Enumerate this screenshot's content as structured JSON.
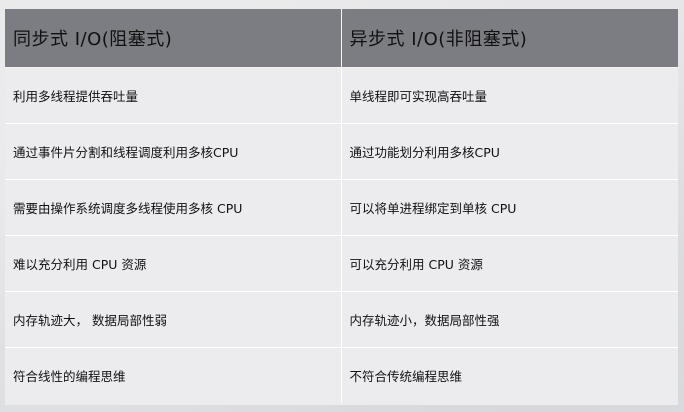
{
  "table": {
    "headers": [
      "同步式 I/O(阻塞式)",
      "异步式 I/O(非阻塞式)"
    ],
    "rows": [
      [
        "利用多线程提供吞吐量",
        "单线程即可实现高吞吐量"
      ],
      [
        "通过事件片分割和线程调度利用多核CPU",
        "通过功能划分利用多核CPU"
      ],
      [
        "需要由操作系统调度多线程使用多核 CPU",
        "可以将单进程绑定到单核 CPU"
      ],
      [
        "难以充分利用 CPU 资源",
        "可以充分利用 CPU 资源"
      ],
      [
        "内存轨迹大， 数据局部性弱",
        "内存轨迹小，数据局部性强"
      ],
      [
        "符合线性的编程思维",
        "不符合传统编程思维"
      ]
    ]
  },
  "colors": {
    "header_bg": "#7c7d82",
    "cell_bg": "#ececee",
    "border": "#ffffff"
  }
}
